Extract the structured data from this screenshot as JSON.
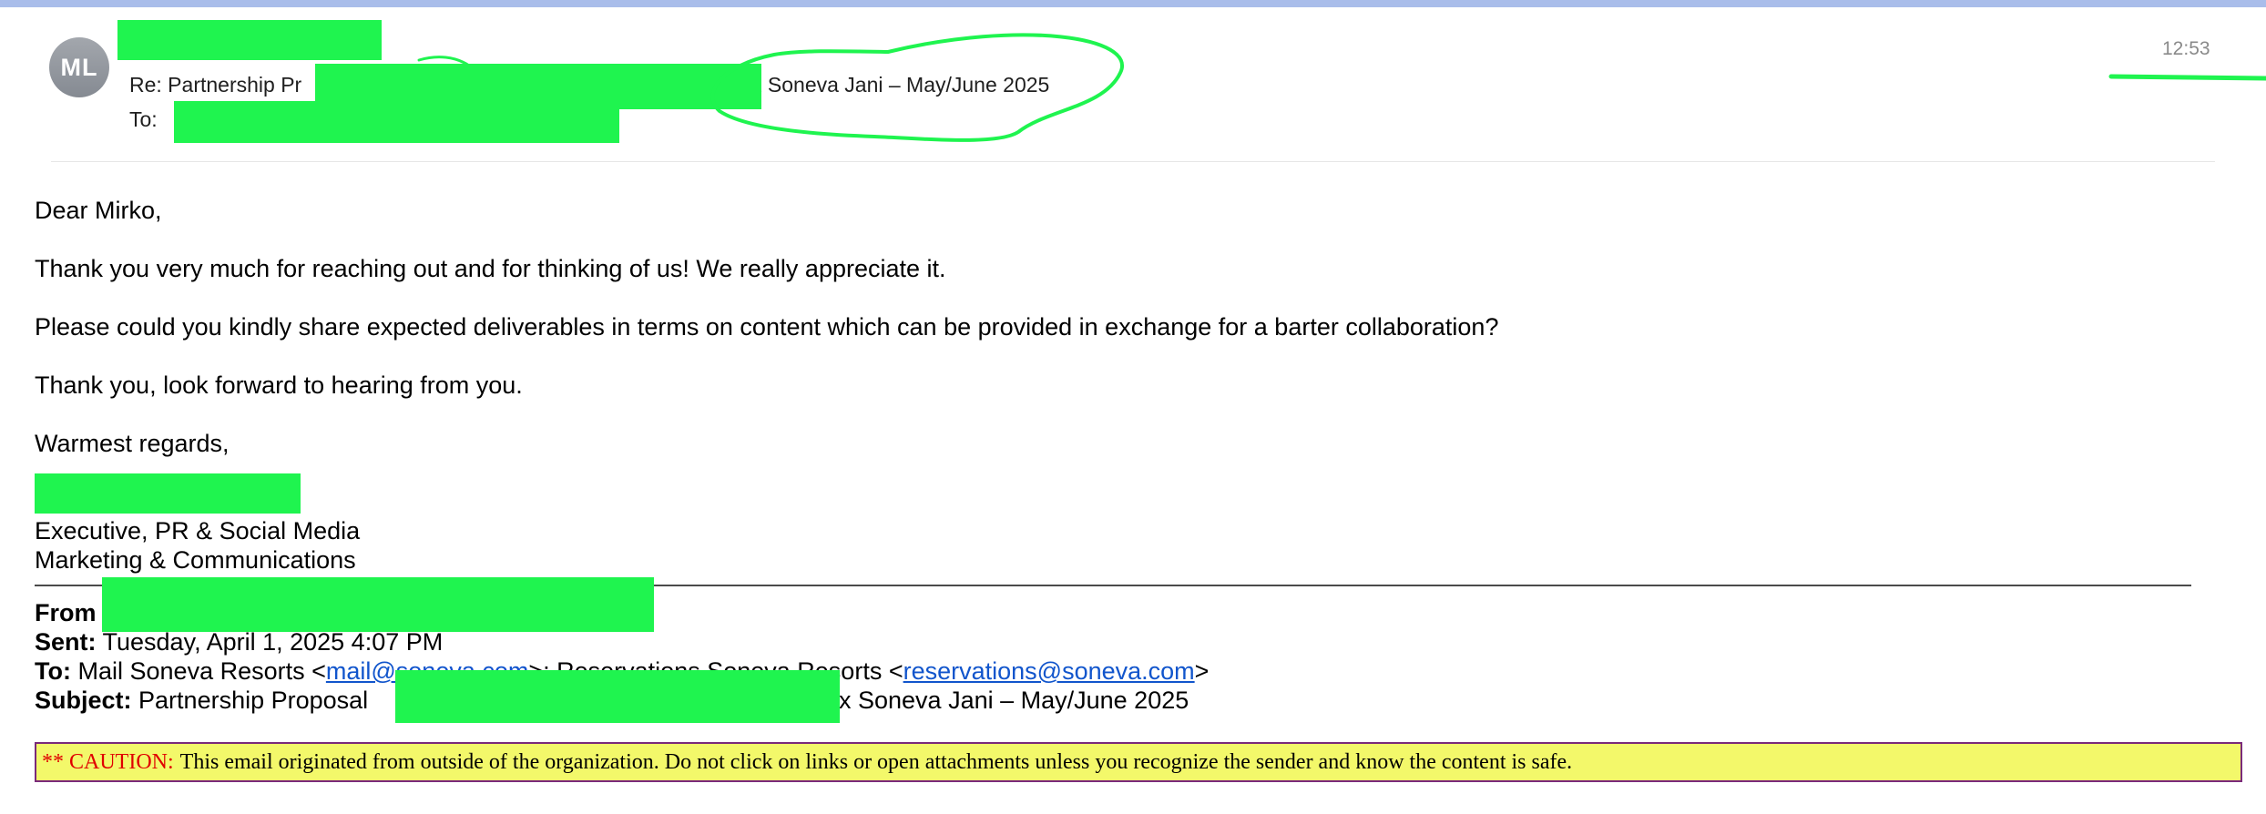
{
  "header": {
    "avatar_initials": "ML",
    "subject_prefix": "Re: Partnership Pr",
    "subject_suffix": "x Soneva Jani – May/June 2025",
    "to_label": "To:",
    "time": "12:53"
  },
  "body": {
    "greeting": "Dear Mirko,",
    "para1": "Thank you very much for reaching out and for thinking of us! We really appreciate it.",
    "para2": "Please could you kindly share expected deliverables in terms on content which can be provided in exchange for a barter collaboration?",
    "para3": "Thank you, look forward to hearing from you.",
    "closing": "Warmest regards,",
    "signature_title": "Executive, PR & Social Media",
    "signature_dept": "Marketing & Communications"
  },
  "forwarded": {
    "from_label": "From",
    "sent_label": "Sent:",
    "sent_value": "Tuesday, April 1, 2025 4:07 PM",
    "to_label": "To:",
    "to_name1": "Mail Soneva Resorts <",
    "to_email1": "mail@soneva.com",
    "to_mid": ">; Reservations Soneva Resorts <",
    "to_email2": "reservations@soneva.com",
    "to_end": ">",
    "subject_label": "Subject:",
    "subject_prefix": "Partnership Proposal",
    "subject_suffix": "x Soneva Jani – May/June 2025"
  },
  "caution": {
    "label": "** CAUTION:",
    "text": "This email originated from outside of the organization. Do not click on links or open attachments unless you recognize the sender and know the content is safe."
  },
  "colors": {
    "redaction": "#1ff44f",
    "annotation": "#1ff44f",
    "caution_bg": "#f3f86a",
    "caution_label": "#e00000",
    "link": "#1155cc"
  }
}
